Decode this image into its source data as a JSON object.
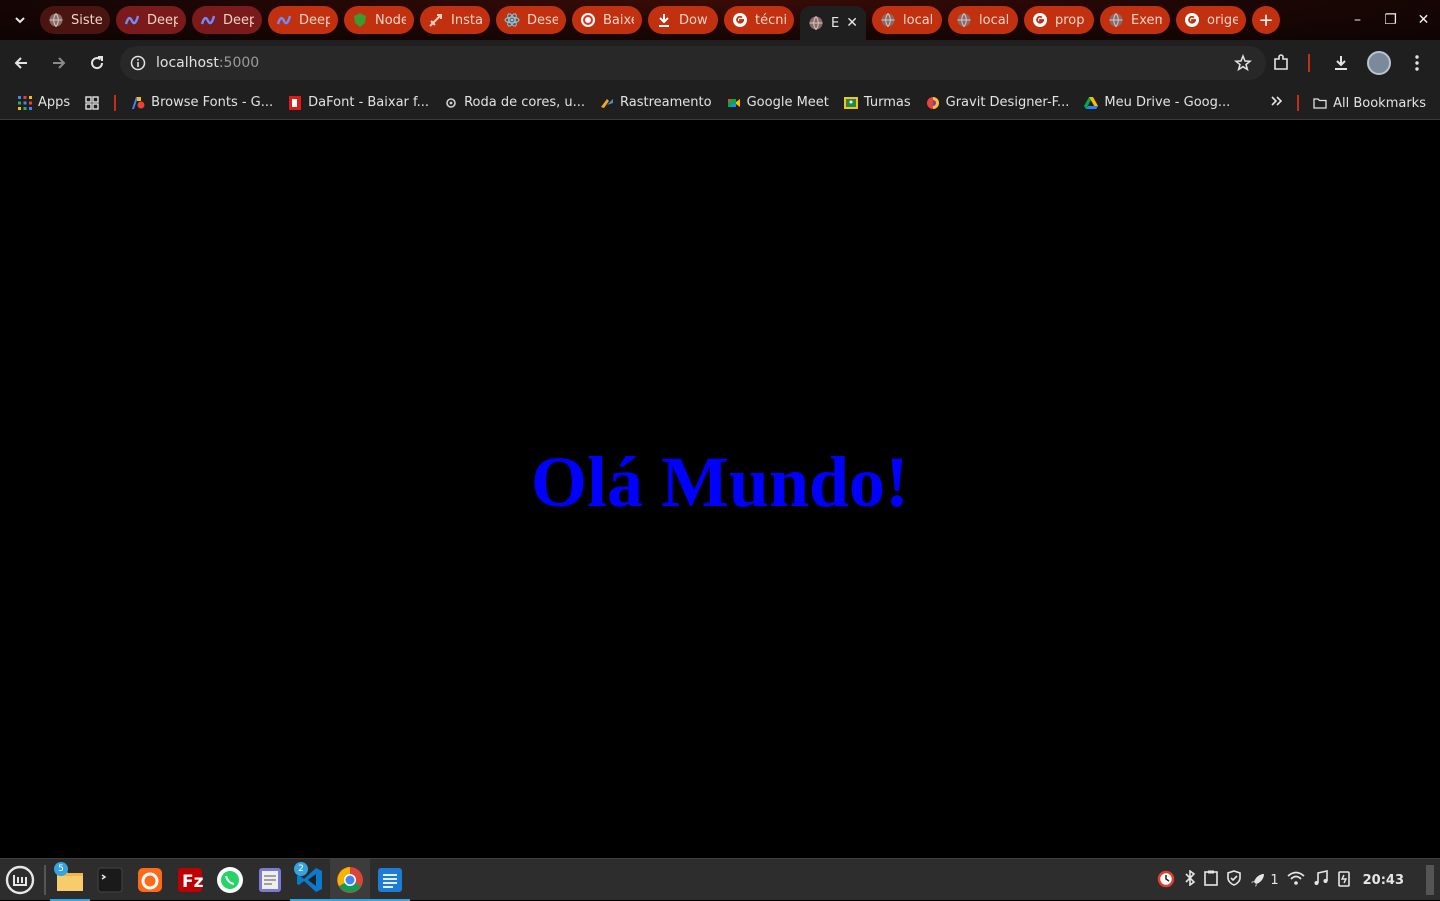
{
  "browser": {
    "tabs": [
      {
        "label": "Sistem",
        "icon": "globe-icon",
        "style": "dark"
      },
      {
        "label": "Deep",
        "icon": "deepl-icon",
        "style": "pink"
      },
      {
        "label": "Deep",
        "icon": "deepl-icon",
        "style": "pink"
      },
      {
        "label": "Deep",
        "icon": "deepl-icon",
        "style": "normal"
      },
      {
        "label": "Node",
        "icon": "shield-icon",
        "style": "normal"
      },
      {
        "label": "Insta",
        "icon": "insta-icon",
        "style": "normal"
      },
      {
        "label": "Dese",
        "icon": "react-icon",
        "style": "normal"
      },
      {
        "label": "Baixe",
        "icon": "download-circle-icon",
        "style": "normal"
      },
      {
        "label": "Dow",
        "icon": "download-icon",
        "style": "normal"
      },
      {
        "label": "técni",
        "icon": "google-icon",
        "style": "normal"
      },
      {
        "label": "E",
        "icon": "globe-icon",
        "style": "active"
      },
      {
        "label": "local",
        "icon": "globe-icon",
        "style": "normal"
      },
      {
        "label": "local",
        "icon": "globe-icon",
        "style": "normal"
      },
      {
        "label": "prop",
        "icon": "google-icon",
        "style": "normal"
      },
      {
        "label": "Exem",
        "icon": "globe-icon",
        "style": "normal"
      },
      {
        "label": "orige",
        "icon": "google-icon",
        "style": "normal"
      }
    ],
    "new_tab": "+",
    "address": {
      "host": "localhost",
      "port": ":5000"
    },
    "bookmarks": [
      {
        "label": "Apps",
        "icon": "apps-grid-icon"
      },
      {
        "label": "Browse Fonts - G...",
        "icon": "google-fonts-icon"
      },
      {
        "label": "DaFont - Baixar f...",
        "icon": "dafont-icon"
      },
      {
        "label": "Roda de cores, u...",
        "icon": "color-wheel-icon"
      },
      {
        "label": "Rastreamento",
        "icon": "truck-icon"
      },
      {
        "label": "Google Meet",
        "icon": "meet-icon"
      },
      {
        "label": "Turmas",
        "icon": "classroom-icon"
      },
      {
        "label": "Gravit Designer-F...",
        "icon": "gravit-icon"
      },
      {
        "label": "Meu Drive - Goog...",
        "icon": "drive-icon"
      }
    ],
    "all_bookmarks": "All Bookmarks"
  },
  "page": {
    "heading": "Olá Mundo!"
  },
  "taskbar": {
    "files_badge": "5",
    "vscode_badge": "2",
    "notifications_count": "1",
    "clock": "20:43"
  },
  "colors": {
    "tab_accent": "#c1300f",
    "heading_color": "#0000ff",
    "page_background": "#000000"
  }
}
